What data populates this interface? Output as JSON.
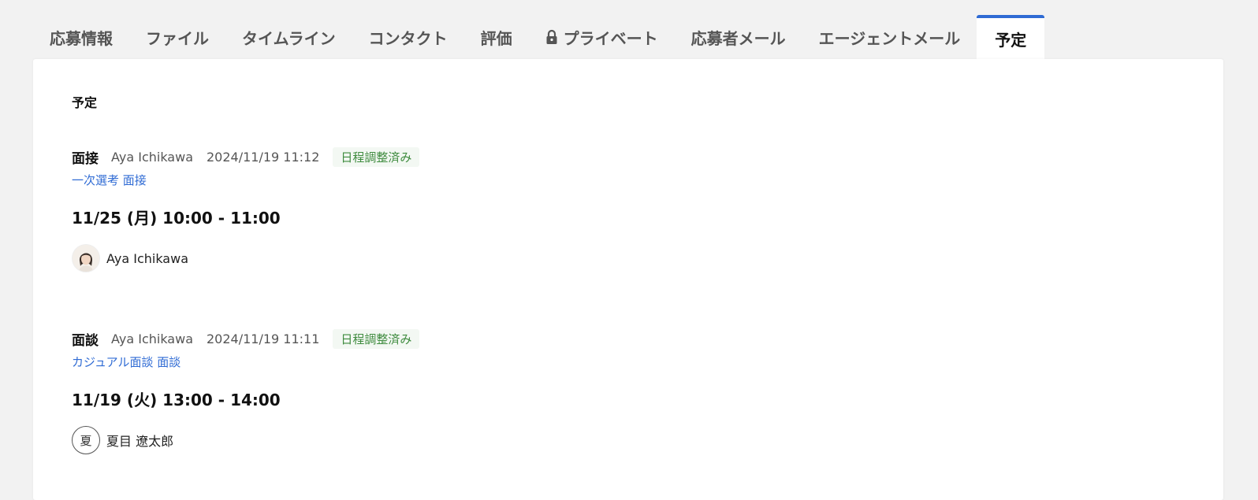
{
  "tabs": [
    {
      "label": "応募情報"
    },
    {
      "label": "ファイル"
    },
    {
      "label": "タイムライン"
    },
    {
      "label": "コンタクト"
    },
    {
      "label": "評価"
    },
    {
      "label": "プライベート",
      "icon": "lock-icon"
    },
    {
      "label": "応募者メール"
    },
    {
      "label": "エージェントメール"
    },
    {
      "label": "予定",
      "active": true
    }
  ],
  "panel": {
    "title": "予定"
  },
  "events": [
    {
      "type": "面接",
      "author": "Aya Ichikawa",
      "date": "2024/11/19 11:12",
      "status": "日程調整済み",
      "link": "一次選考 面接",
      "time": "11/25 (月) 10:00 - 11:00",
      "person": {
        "name": "Aya Ichikawa",
        "avatar": "photo"
      }
    },
    {
      "type": "面談",
      "author": "Aya Ichikawa",
      "date": "2024/11/19 11:11",
      "status": "日程調整済み",
      "link": "カジュアル面談 面談",
      "time": "11/19 (火) 13:00 - 14:00",
      "person": {
        "name": "夏目 遼太郎",
        "avatar": "initial",
        "initial": "夏"
      }
    }
  ],
  "colors": {
    "accent": "#2f6bd4",
    "status": "#3e8b3e"
  }
}
